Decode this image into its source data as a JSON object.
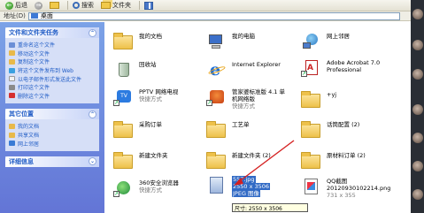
{
  "toolbar": {
    "back_label": "后退",
    "search_label": "搜索",
    "folders_label": "文件夹"
  },
  "address": {
    "label": "地址(D)",
    "value": "桌面"
  },
  "task_pane": {
    "file_tasks": {
      "title": "文件和文件夹任务",
      "items": [
        {
          "label": "重命名这个文件",
          "icon": "rename-icon"
        },
        {
          "label": "移动这个文件",
          "icon": "move-icon"
        },
        {
          "label": "复制这个文件",
          "icon": "copy-icon"
        },
        {
          "label": "将这个文件发布到 Web",
          "icon": "web-publish-icon"
        },
        {
          "label": "以电子邮件形式发送此文件",
          "icon": "email-icon"
        },
        {
          "label": "打印这个文件",
          "icon": "print-icon"
        },
        {
          "label": "删除这个文件",
          "icon": "delete-icon"
        }
      ]
    },
    "other_places": {
      "title": "其它位置",
      "items": [
        {
          "label": "我的文档",
          "icon": "documents-icon"
        },
        {
          "label": "共享文档",
          "icon": "shared-docs-icon"
        },
        {
          "label": "网上邻居",
          "icon": "network-icon"
        }
      ]
    },
    "details": {
      "title": "详细信息"
    }
  },
  "files": [
    {
      "name": "我的文档",
      "sub": "",
      "icon": "my-documents-icon"
    },
    {
      "name": "我的电脑",
      "sub": "",
      "icon": "my-computer-icon"
    },
    {
      "name": "网上邻居",
      "sub": "",
      "icon": "network-places-icon"
    },
    {
      "name": "回收站",
      "sub": "",
      "icon": "recycle-bin-icon"
    },
    {
      "name": "Internet Explorer",
      "sub": "",
      "icon": "ie-icon"
    },
    {
      "name": "Adobe Acrobat 7.0",
      "sub": "Professional",
      "icon": "acrobat-icon"
    },
    {
      "name": "PPTV 网络电视",
      "sub": "快捷方式",
      "icon": "pptv-icon"
    },
    {
      "name": "管家婆标准版 4.1 单",
      "sub": "机网络版",
      "icon": "guanjiapo-icon"
    },
    {
      "name": "快捷方式",
      "sub": "",
      "icon": "shortcut-icon"
    },
    {
      "name": "+yj",
      "sub": "",
      "icon": "folder-icon"
    },
    {
      "name": "采购订单",
      "sub": "",
      "icon": "folder-icon"
    },
    {
      "name": "工艺单",
      "sub": "",
      "icon": "folder-icon"
    },
    {
      "name": "话筒配置 (2)",
      "sub": "",
      "icon": "folder-icon"
    },
    {
      "name": "新建文件夹",
      "sub": "",
      "icon": "folder-icon"
    },
    {
      "name": "新建文件夹 (2)",
      "sub": "",
      "icon": "folder-icon"
    },
    {
      "name": "原材料订单 (2)",
      "sub": "",
      "icon": "folder-icon"
    },
    {
      "name": "360安全浏览器",
      "sub": "快捷方式",
      "icon": "browser-360-icon"
    },
    {
      "name": "557.jpg",
      "sub": "2550 x 3506",
      "sub2": "JPEG 图像",
      "icon": "image-file-icon"
    },
    {
      "name": "QQ截图",
      "sub": "20120930102214.png",
      "sub2": "731 x 355",
      "icon": "png-file-icon"
    }
  ],
  "tooltip": {
    "text": "尺寸: 2550 x 3506"
  },
  "colors": {
    "pane_top": "#7ba2e7",
    "pane_bottom": "#6375d6",
    "link": "#215dc6",
    "selection": "#316ac5"
  }
}
